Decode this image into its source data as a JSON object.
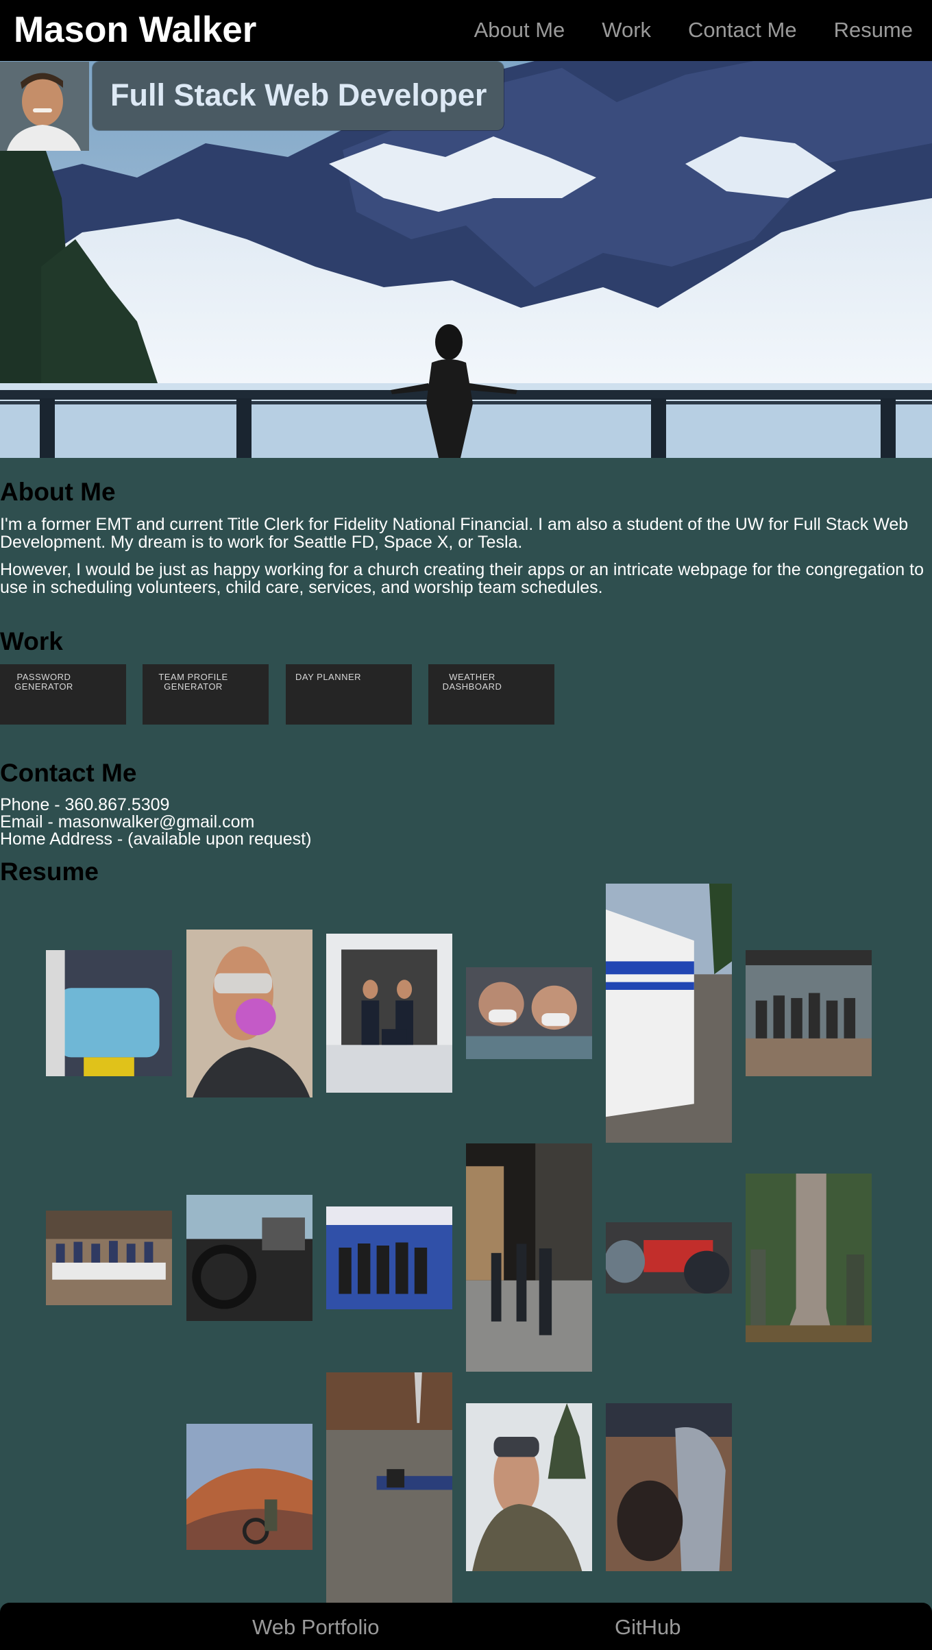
{
  "header": {
    "name": "Mason Walker",
    "nav": [
      "About Me",
      "Work",
      "Contact Me",
      "Resume"
    ]
  },
  "hero": {
    "subtitle": "Full Stack Web Developer"
  },
  "about": {
    "heading": "About Me",
    "paragraphs": [
      "I'm a former EMT and current Title Clerk for Fidelity National Financial. I am also a student of the UW for Full Stack Web Development. My dream is to work for Seattle FD, Space X, or Tesla.",
      "However, I would be just as happy working for a church creating their apps or an intricate webpage for the congregation to use in scheduling volunteers, child care, services, and worship team schedules."
    ]
  },
  "work": {
    "heading": "Work",
    "projects": [
      "Password\nGenerator",
      "Team Profile\nGenerator",
      "Day Planner",
      "Weather\nDashboard"
    ]
  },
  "contact": {
    "heading": "Contact Me",
    "phone": "Phone - 360.867.5309",
    "email": "Email - masonwalker@gmail.com",
    "address": "Home Address - (available upon request)"
  },
  "resume": {
    "heading": "Resume"
  },
  "footer": {
    "links": [
      "Web Portfolio",
      "GitHub"
    ]
  },
  "colors": {
    "background": "#2f4f4f",
    "header": "#000000",
    "nav_text": "#9a9a9a",
    "subtitle_box": "#4a5a63",
    "heading": "#000000"
  }
}
